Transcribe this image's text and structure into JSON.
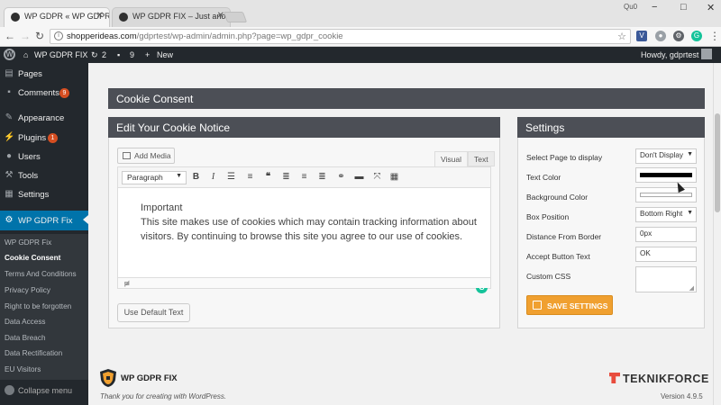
{
  "browser": {
    "tabs": [
      {
        "label": "WP GDPR « WP GDPR FIX"
      },
      {
        "label": "WP GDPR FIX – Just anot"
      }
    ],
    "profile_label": "Qu0",
    "url_host": "shopperideas.com",
    "url_path": "/gdprtest/wp-admin/admin.php?page=wp_gdpr_cookie",
    "window_controls": [
      "−",
      "□",
      "✕"
    ]
  },
  "adminbar": {
    "site_name": "WP GDPR FIX",
    "updates_count": "2",
    "comments_count": "9",
    "new_label": "New",
    "greeting": "Howdy, gdprtest"
  },
  "sidebar": {
    "items": [
      {
        "label": "Pages",
        "icon": "pages-icon"
      },
      {
        "label": "Comments",
        "icon": "comments-icon",
        "badge": "9"
      },
      {
        "label": "Appearance",
        "icon": "appearance-icon"
      },
      {
        "label": "Plugins",
        "icon": "plugins-icon",
        "badge": "1"
      },
      {
        "label": "Users",
        "icon": "users-icon"
      },
      {
        "label": "Tools",
        "icon": "tools-icon"
      },
      {
        "label": "Settings",
        "icon": "settings-icon"
      },
      {
        "label": "WP GDPR Fix",
        "icon": "shield-icon"
      }
    ],
    "submenu": [
      "WP GDPR Fix",
      "Cookie Consent",
      "Terms And Conditions",
      "Privacy Policy",
      "Right to be forgotten",
      "Data Access",
      "Data Breach",
      "Data Rectification",
      "EU Visitors"
    ],
    "collapse_label": "Collapse menu"
  },
  "page": {
    "title": "Cookie Consent",
    "editor_panel_title": "Edit Your Cookie Notice",
    "settings_panel_title": "Settings"
  },
  "editor": {
    "add_media_label": "Add Media",
    "tab_visual": "Visual",
    "tab_text": "Text",
    "format_select": "Paragraph",
    "content": {
      "line1": "Important",
      "line2": "This site makes use of cookies which may contain tracking information about",
      "line3": "visitors. By continuing to browse this site you agree to our use of cookies."
    },
    "status_path": "p",
    "default_button": "Use Default Text"
  },
  "settings": {
    "fields": [
      {
        "label": "Select Page to display",
        "value": "Don't Display"
      },
      {
        "label": "Text Color",
        "color": "#000000"
      },
      {
        "label": "Background Color",
        "color": "#ffffff"
      },
      {
        "label": "Box Position",
        "value": "Bottom Right"
      },
      {
        "label": "Distance From Border",
        "value": "0px"
      },
      {
        "label": "Accept Button Text",
        "value": "OK"
      },
      {
        "label": "Custom CSS",
        "value": ""
      }
    ],
    "save_button": "SAVE SETTINGS"
  },
  "footer": {
    "brand": "WP GDPR FIX",
    "thanks": "Thank you for creating with WordPress.",
    "partner_logo": "TEKNIKFORCE",
    "version": "Version 4.9.5"
  },
  "colors": {
    "wp_dark": "#23282d",
    "wp_blue": "#0073aa",
    "panel_header": "#4c4f56",
    "save_orange": "#f0a030",
    "badge_red": "#d54e21"
  }
}
